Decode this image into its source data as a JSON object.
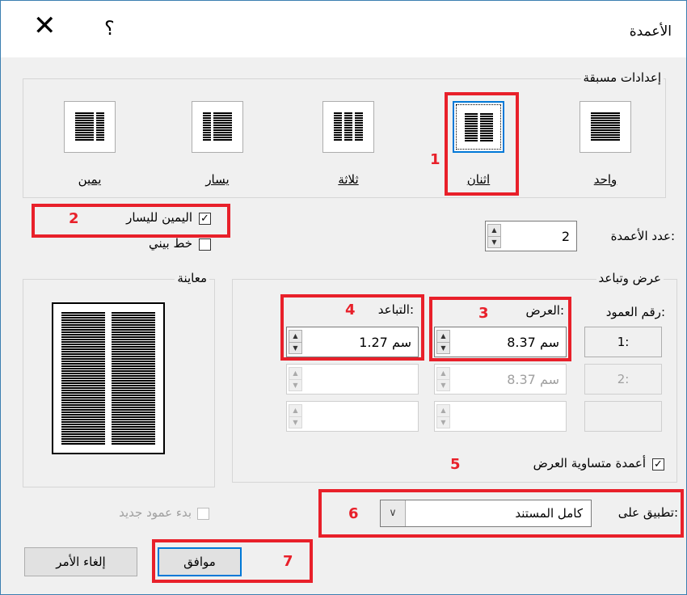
{
  "dialog": {
    "title": "الأعمدة",
    "help_glyph": "؟",
    "close_glyph": "✕"
  },
  "presets": {
    "legend": "إعدادات مسبقة",
    "items": [
      {
        "label": "واحد",
        "icon": "one-column-icon",
        "selected": false
      },
      {
        "label": "اثنان",
        "icon": "two-columns-icon",
        "selected": true
      },
      {
        "label": "ثلاثة",
        "icon": "three-columns-icon",
        "selected": false
      },
      {
        "label": "يسار",
        "icon": "left-column-icon",
        "selected": false
      },
      {
        "label": "يمين",
        "icon": "right-column-icon",
        "selected": false
      }
    ]
  },
  "num_columns": {
    "label": "عدد الأعمدة:",
    "value": "2"
  },
  "right_to_left": {
    "label": "اليمين لليسار",
    "checked": true
  },
  "line_between": {
    "label": "خط بيني",
    "checked": false
  },
  "width_spacing": {
    "legend": "عرض وتباعد",
    "col_header": "رقم العمود:",
    "width_header": "العرض:",
    "spacing_header": "التباعد:",
    "rows": [
      {
        "num": "1:",
        "width": "8.37 سم",
        "spacing": "1.27 سم",
        "enabled": true
      },
      {
        "num": "2:",
        "width": "8.37 سم",
        "spacing": "",
        "enabled": false
      },
      {
        "num": "",
        "width": "",
        "spacing": "",
        "enabled": false
      }
    ]
  },
  "equal_width": {
    "label": "أعمدة متساوية العرض",
    "checked": true
  },
  "preview": {
    "legend": "معاينة"
  },
  "apply_to": {
    "label": "تطبيق على:",
    "value": "كامل المستند"
  },
  "start_new_column": {
    "label": "بدء عمود جديد",
    "checked": false
  },
  "buttons": {
    "ok": "موافق",
    "cancel": "إلغاء الأمر"
  },
  "annotations": [
    "1",
    "2",
    "3",
    "4",
    "5",
    "6",
    "7"
  ],
  "colors": {
    "annotation": "#e8202a",
    "focus": "#0078d7"
  }
}
